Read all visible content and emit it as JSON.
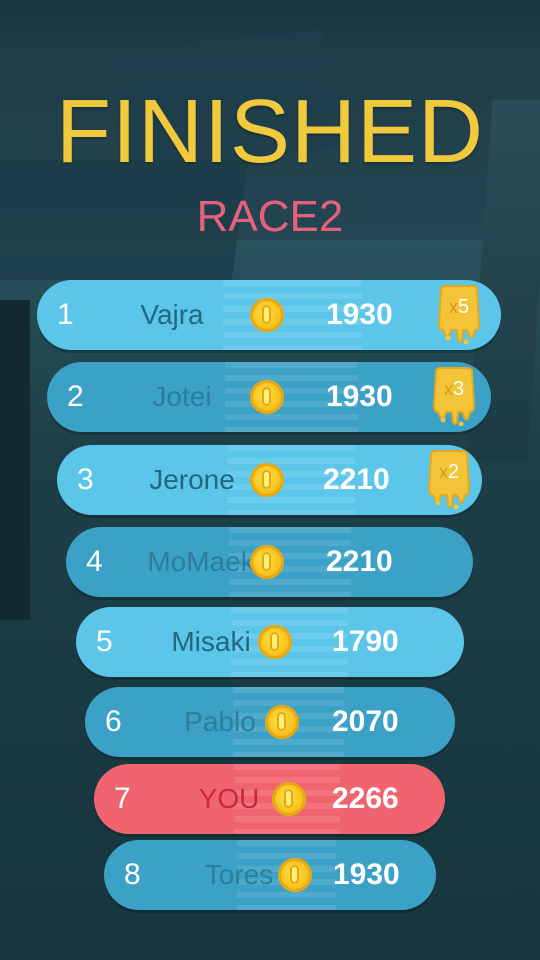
{
  "screen": {
    "title": "FINISHED",
    "subtitle": "RACE2"
  },
  "leaderboard": [
    {
      "rank": "1",
      "name": "Vajra",
      "score": "1930",
      "multiplier": "5",
      "style": "light"
    },
    {
      "rank": "2",
      "name": "Jotei",
      "score": "1930",
      "multiplier": "3",
      "style": "dark"
    },
    {
      "rank": "3",
      "name": "Jerone",
      "score": "2210",
      "multiplier": "2",
      "style": "light"
    },
    {
      "rank": "4",
      "name": "MoMaek",
      "score": "2210",
      "multiplier": null,
      "style": "dark"
    },
    {
      "rank": "5",
      "name": "Misaki",
      "score": "1790",
      "multiplier": null,
      "style": "light"
    },
    {
      "rank": "6",
      "name": "Pablo",
      "score": "2070",
      "multiplier": null,
      "style": "dark"
    },
    {
      "rank": "7",
      "name": "YOU",
      "score": "2266",
      "multiplier": null,
      "style": "you"
    },
    {
      "rank": "8",
      "name": "Tores",
      "score": "1930",
      "multiplier": null,
      "style": "dark"
    }
  ],
  "badge_prefix": "x",
  "icons": {
    "coin": "gold-coin-icon",
    "multiplier": "slime-multiplier-badge-icon"
  },
  "colors": {
    "title": "#f0c93c",
    "subtitle": "#e8607a",
    "row_light": "#5cc6ea",
    "row_dark": "#3ba1c6",
    "row_you": "#f0646f",
    "coin": "#f6c21c"
  }
}
